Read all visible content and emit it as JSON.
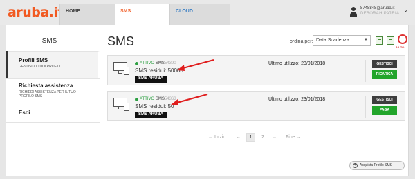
{
  "header": {
    "logo": "aruba.it",
    "tabs": [
      {
        "label": "HOME"
      },
      {
        "label": "SMS"
      },
      {
        "label": "CLOUD"
      }
    ],
    "user": {
      "email": "8748848@aruba.it",
      "name": "DEBORAH PATRIA"
    }
  },
  "sidebar": {
    "title": "SMS",
    "items": [
      {
        "label": "Profili SMS",
        "sub": "GESTISCI I TUOI PROFILI"
      },
      {
        "label": "Richiesta assistenza",
        "sub": "RICHIEDI ASSISTENZA PER IL TUO PROFILO SMS"
      },
      {
        "label": "Esci",
        "sub": ""
      }
    ]
  },
  "main": {
    "title": "SMS",
    "sort_label": "ordina per:",
    "sort_value": "Data Scadenza",
    "help_label": "AIUTO",
    "cards": [
      {
        "status": "ATTIVO",
        "prefix": "SMS",
        "id_blur": "54390",
        "credits": "SMS residui: 50000",
        "tag": "SMS ARUBA",
        "last_use": "Ultimo utilizzo: 23/01/2018",
        "btn_manage": "GESTISCI",
        "btn_action": "RICARICA"
      },
      {
        "status": "ATTIVO",
        "prefix": "SMS",
        "id_blur": "54363",
        "credits": "SMS residui: 50",
        "tag": "SMS ARUBA",
        "last_use": "Ultimo utilizzo: 23/01/2018",
        "btn_manage": "GESTISCI",
        "btn_action": "PAGA"
      }
    ],
    "pager": {
      "first": "← Inizio",
      "prev": "←",
      "page1": "1",
      "page2": "2",
      "next": "→",
      "last": "Fine →"
    },
    "buy_button": "Acquista Profilo SMS"
  },
  "colors": {
    "brand": "#f15a22",
    "success": "#22a52b",
    "dark": "#3d3d3d",
    "cloud": "#3b7fc4"
  }
}
